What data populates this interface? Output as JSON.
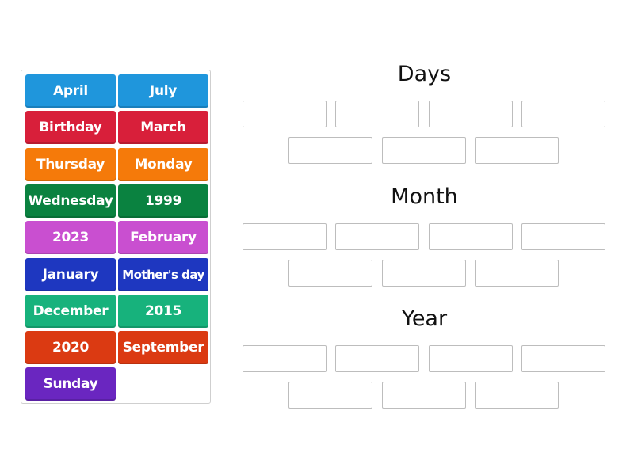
{
  "tiles": [
    {
      "label": "April",
      "color": "#1f96dc"
    },
    {
      "label": "July",
      "color": "#1f96dc"
    },
    {
      "label": "Birthday",
      "color": "#d81f3a"
    },
    {
      "label": "March",
      "color": "#d81f3a"
    },
    {
      "label": "Thursday",
      "color": "#f57a0a"
    },
    {
      "label": "Monday",
      "color": "#f57a0a"
    },
    {
      "label": "Wednesday",
      "color": "#0a8240"
    },
    {
      "label": "1999",
      "color": "#0a8240"
    },
    {
      "label": "2023",
      "color": "#c94fd0"
    },
    {
      "label": "February",
      "color": "#c94fd0"
    },
    {
      "label": "January",
      "color": "#1e37c0"
    },
    {
      "label": "Mother's day",
      "color": "#1e37c0"
    },
    {
      "label": "December",
      "color": "#17b27c"
    },
    {
      "label": "2015",
      "color": "#17b27c"
    },
    {
      "label": "2020",
      "color": "#db3a12"
    },
    {
      "label": "September",
      "color": "#db3a12"
    },
    {
      "label": "Sunday",
      "color": "#6a26c0"
    }
  ],
  "groups": [
    {
      "title": "Days",
      "slot_count": 7
    },
    {
      "title": "Month",
      "slot_count": 7
    },
    {
      "title": "Year",
      "slot_count": 7
    }
  ]
}
